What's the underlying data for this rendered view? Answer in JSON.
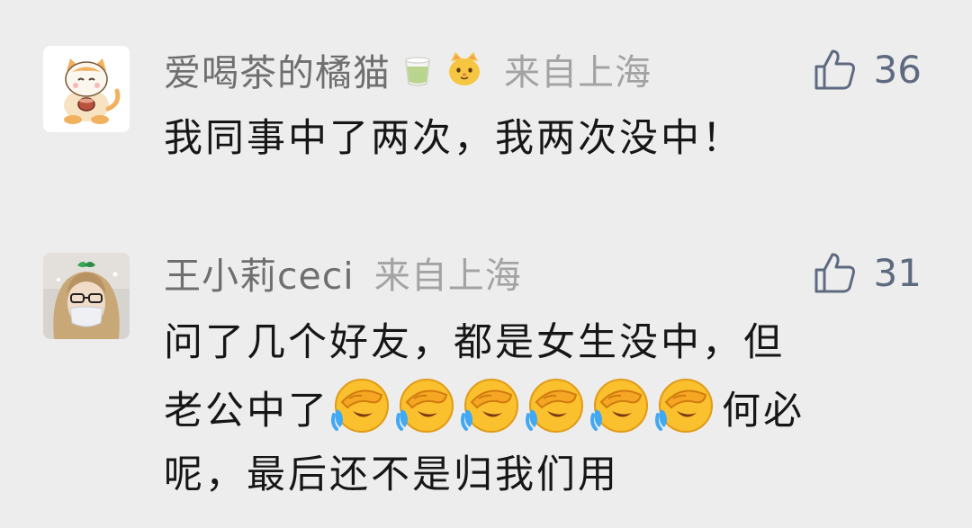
{
  "comments": [
    {
      "username": "爱喝茶的橘猫",
      "badges": [
        "tea-cup-icon",
        "cat-face-icon"
      ],
      "location": "来自上海",
      "likes": "36",
      "text": "我同事中了两次，我两次没中！"
    },
    {
      "username": "王小莉ceci",
      "location": "来自上海",
      "likes": "31",
      "text_line1": "问了几个好友，都是女生没中，但",
      "text_line2_before": "老公中了",
      "emojis": [
        "face-palm-cry-icon",
        "face-palm-cry-icon",
        "face-palm-cry-icon",
        "face-palm-cry-icon",
        "face-palm-cry-icon",
        "face-palm-cry-icon"
      ],
      "text_line2_after": "何必",
      "text_line3": "呢，最后还不是归我们用"
    }
  ],
  "colors": {
    "background": "#ededed",
    "username": "#6f6f6f",
    "location": "#a3a3a3",
    "like": "#5d6a80",
    "body": "#161616"
  }
}
